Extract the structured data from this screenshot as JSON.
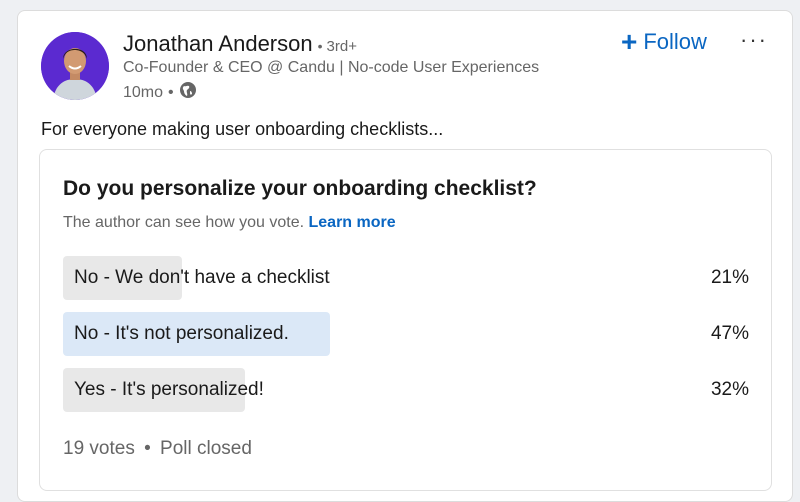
{
  "author": {
    "name": "Jonathan Anderson",
    "degree": "3rd+",
    "headline": "Co-Founder & CEO @ Candu | No-code User Experiences",
    "time": "10mo",
    "visibility_icon": "globe-icon"
  },
  "actions": {
    "follow_icon": "plus-icon",
    "follow_label": "Follow",
    "more_label": "···"
  },
  "post": {
    "text": "For everyone making user onboarding checklists..."
  },
  "poll": {
    "question": "Do you personalize your onboarding checklist?",
    "note": "The author can see how you vote.",
    "learn_more": "Learn more",
    "options": [
      {
        "label": "No - We don't have a checklist",
        "percent_label": "21%",
        "percent": 21,
        "selected": false
      },
      {
        "label": "No - It's not personalized.",
        "percent_label": "47%",
        "percent": 47,
        "selected": true
      },
      {
        "label": "Yes - It's personalized!",
        "percent_label": "32%",
        "percent": 32,
        "selected": false
      }
    ],
    "votes": "19 votes",
    "status": "Poll closed"
  },
  "colors": {
    "link": "#0a66c2",
    "avatar_bg": "#5b2ad0",
    "selected_fill": "#dbe8f7",
    "option_fill": "#e8e8e8"
  }
}
